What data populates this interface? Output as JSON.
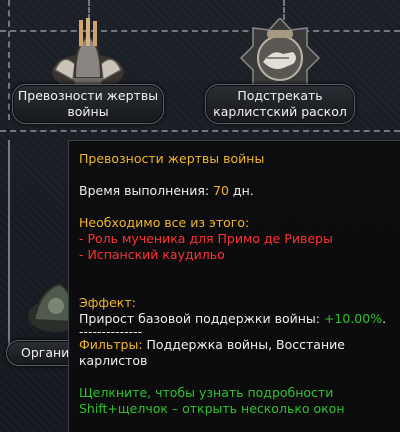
{
  "focuses": {
    "exalt": {
      "label": "Превозности жертвы войны",
      "icon": "helmet-icon"
    },
    "carlist": {
      "label": "Подстрекать карлистский раскол",
      "icon": "handshake-icon"
    },
    "partial": {
      "label": "Органи"
    }
  },
  "tooltip": {
    "title": "Превозности жертвы войны",
    "time_prefix": "Время выполнения: ",
    "time_value": "70",
    "time_suffix": " дн.",
    "required_heading": "Необходимо все из этого:",
    "required_items": [
      "- Роль мученика для Примо де Риверы",
      "- Испанский каудильо"
    ],
    "effect_heading": "Эффект:",
    "effect_text": "Прирост базовой поддержки войны: ",
    "effect_value": "+10.00%",
    "effect_end": ".",
    "separator": "--------------",
    "filters_label": "Фильтры:",
    "filters_text_1": " Поддержка войны, Восстание",
    "filters_text_2": "карлистов",
    "hint_1": "Щелкните, чтобы узнать подробности",
    "hint_2": "Shift+щелчок – открыть несколько окон"
  },
  "colors": {
    "gold": "#f1b52a",
    "red": "#ff3232",
    "green": "#2ec22e"
  }
}
